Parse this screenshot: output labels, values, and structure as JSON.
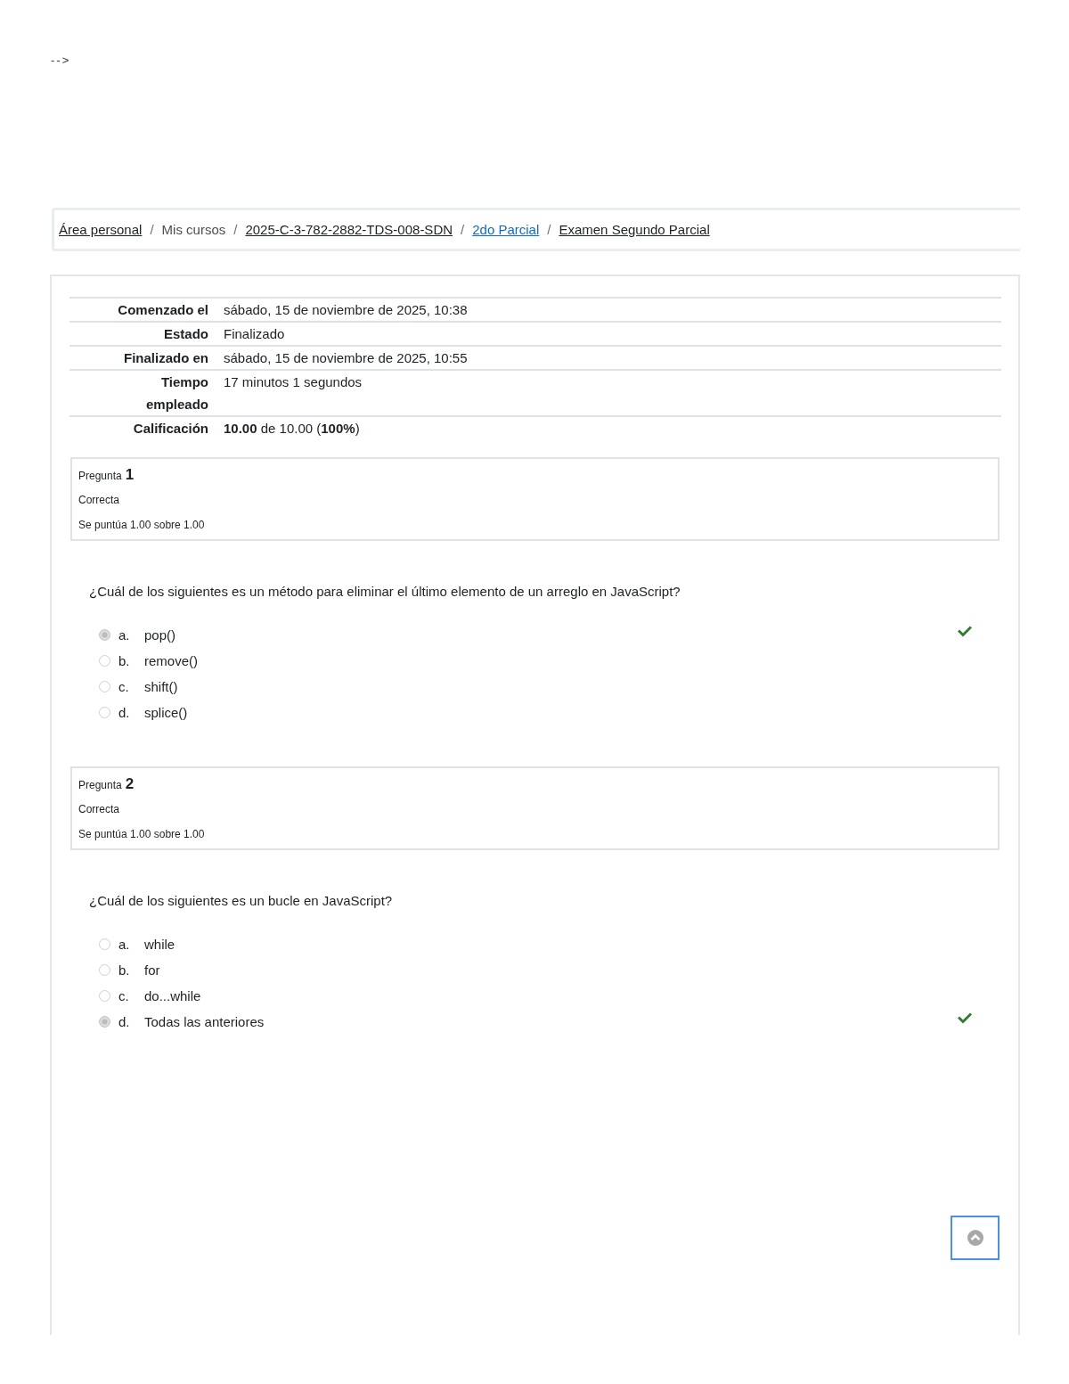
{
  "page_text": "-->",
  "breadcrumb": [
    {
      "label": "Área personal",
      "kind": "link",
      "separator": "/"
    },
    {
      "label": "Mis cursos",
      "kind": "text",
      "separator": "/"
    },
    {
      "label": "2025-C-3-782-2882-TDS-008-SDN",
      "kind": "link",
      "separator": "/"
    },
    {
      "label": "2do Parcial",
      "kind": "accent_link",
      "separator": "/"
    },
    {
      "label": "Examen Segundo Parcial",
      "kind": "link"
    }
  ],
  "summary": [
    {
      "label": "Comenzado el",
      "value": "sábado, 15 de noviembre de 2025, 10:38"
    },
    {
      "label": "Estado",
      "value": "Finalizado"
    },
    {
      "label": "Finalizado en",
      "value": "sábado, 15 de noviembre de 2025, 10:55"
    },
    {
      "label": "Tiempo empleado",
      "value": "17 minutos 1 segundos"
    },
    {
      "label": "Calificación",
      "value": "**10.00** de 10.00 (**100%**)"
    }
  ],
  "questions": [
    {
      "label": "Pregunta",
      "number": "1",
      "status": "Correcta",
      "grade": "Se puntúa 1.00 sobre 1.00",
      "text": "¿Cuál de los siguientes es un método para eliminar el último elemento de un arreglo en JavaScript?",
      "options": [
        {
          "letter": "a.",
          "text": "pop()",
          "selected": true,
          "marked_correct": true
        },
        {
          "letter": "b.",
          "text": "remove()",
          "selected": false,
          "marked_correct": false
        },
        {
          "letter": "c.",
          "text": "shift()",
          "selected": false,
          "marked_correct": false
        },
        {
          "letter": "d.",
          "text": "splice()",
          "selected": false,
          "marked_correct": false
        }
      ]
    },
    {
      "label": "Pregunta",
      "number": "2",
      "status": "Correcta",
      "grade": "Se puntúa 1.00 sobre 1.00",
      "text": "¿Cuál de los siguientes es un bucle en JavaScript?",
      "options": [
        {
          "letter": "a.",
          "text": "while",
          "selected": false,
          "marked_correct": false
        },
        {
          "letter": "b.",
          "text": "for",
          "selected": false,
          "marked_correct": false
        },
        {
          "letter": "c.",
          "text": "do...while",
          "selected": false,
          "marked_correct": false
        },
        {
          "letter": "d.",
          "text": "Todas las anteriores",
          "selected": true,
          "marked_correct": true
        }
      ]
    }
  ]
}
